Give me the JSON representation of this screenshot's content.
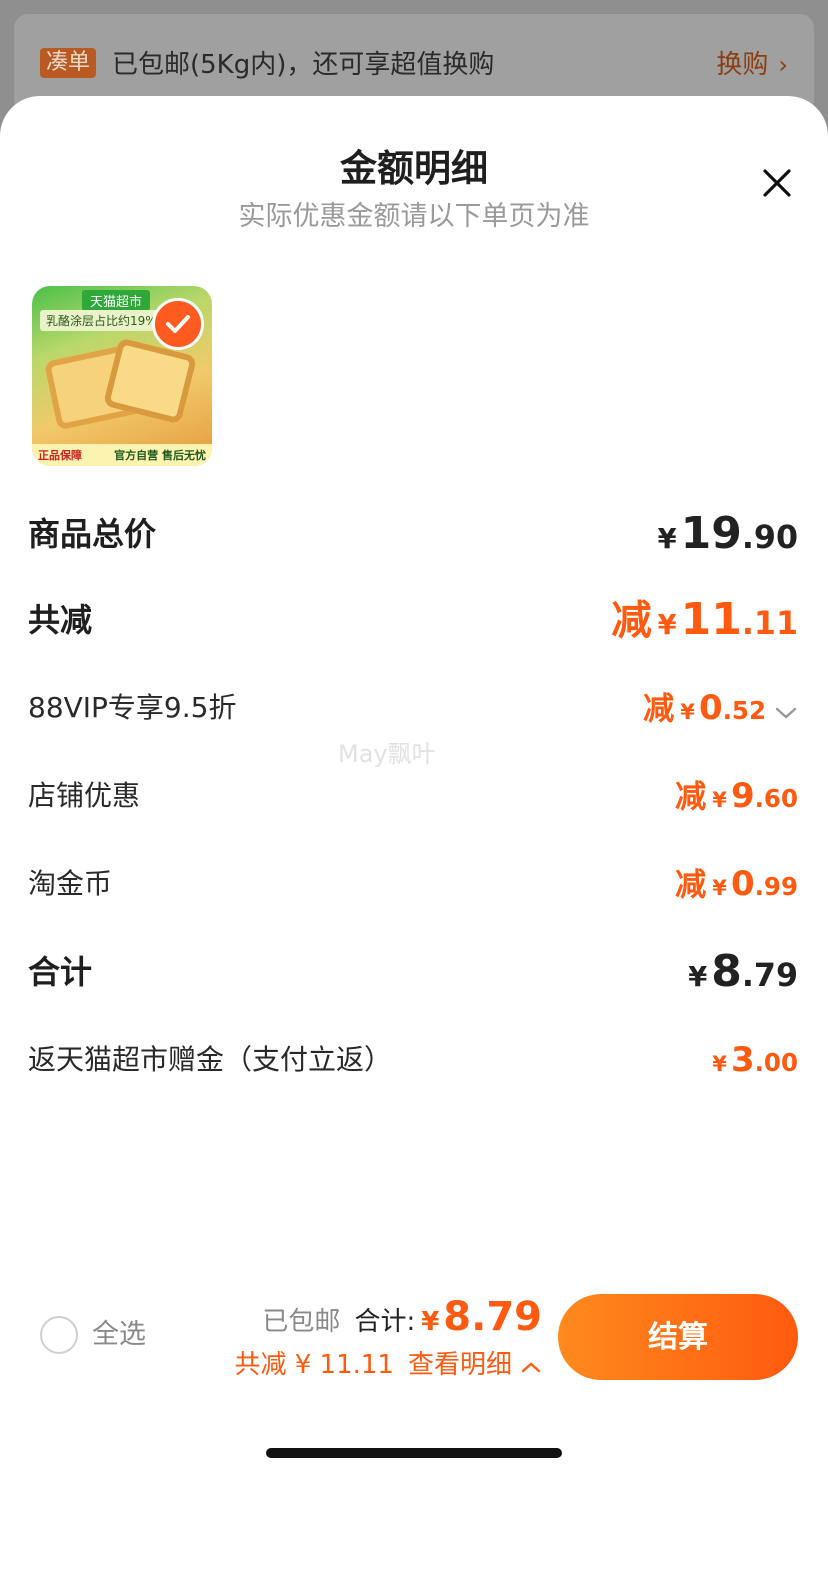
{
  "top_bar": {
    "tag": "凑单",
    "text": "已包邮(5Kg内)，还可享超值换购",
    "link": "换购"
  },
  "sheet": {
    "title": "金额明细",
    "subtitle": "实际优惠金额请以下单页为准"
  },
  "product": {
    "brand": "天猫超市",
    "promo": "乳酪涂层占比约19%",
    "guarantee": "正品保障",
    "official": "官方自营 售后无忧"
  },
  "rows": {
    "subtotal": {
      "label": "商品总价",
      "yen": "¥",
      "int": "19",
      "frac": ".90"
    },
    "discount": {
      "label": "共减",
      "pre": "减",
      "yen": "¥",
      "int": "11",
      "frac": ".11"
    },
    "vip": {
      "label": "88VIP专享9.5折",
      "pre": "减",
      "yen": "¥",
      "int": "0",
      "frac": ".52"
    },
    "shop": {
      "label": "店铺优惠",
      "pre": "减",
      "yen": "¥",
      "int": "9",
      "frac": ".60"
    },
    "coin": {
      "label": "淘金币",
      "pre": "减",
      "yen": "¥",
      "int": "0",
      "frac": ".99"
    },
    "total": {
      "label": "合计",
      "yen": "¥",
      "int": "8",
      "frac": ".79"
    },
    "cashback": {
      "label": "返天猫超市赠金（支付立返）",
      "yen": "¥",
      "int": "3",
      "frac": ".00"
    }
  },
  "watermark": "May飘叶",
  "bottom_bar": {
    "select_all": "全选",
    "shipping": "已包邮",
    "total_label": "合计:",
    "total_yen": "¥",
    "total_value": "8.79",
    "discount_text": "共减 ¥ 11.11",
    "detail_link": "查看明细",
    "checkout": "结算"
  },
  "colors": {
    "accent": "#ff5a0f",
    "tag_bg": "#b85a22"
  }
}
